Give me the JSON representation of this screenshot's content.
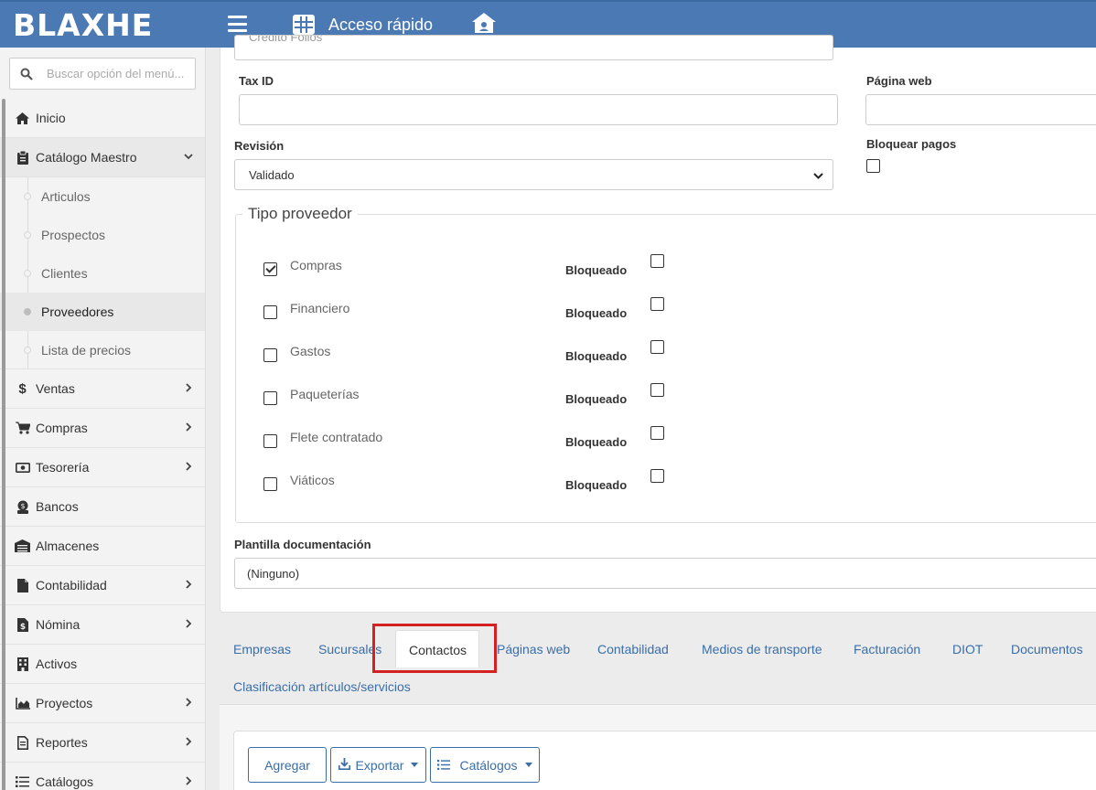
{
  "header": {
    "logo": "BLAXHE",
    "quick_access": "Acceso rápido"
  },
  "sidebar": {
    "search_placeholder": "Buscar opción del menú...",
    "items": [
      {
        "label": "Inicio",
        "icon": "home-icon"
      },
      {
        "label": "Catálogo Maestro",
        "icon": "clipboard-icon",
        "expanded": true,
        "children": [
          "Articulos",
          "Prospectos",
          "Clientes",
          "Proveedores",
          "Lista de precios"
        ],
        "active_child": "Proveedores"
      },
      {
        "label": "Ventas",
        "icon": "dollar-icon"
      },
      {
        "label": "Compras",
        "icon": "cart-icon"
      },
      {
        "label": "Tesorería",
        "icon": "money-icon"
      },
      {
        "label": "Bancos",
        "icon": "bank-icon"
      },
      {
        "label": "Almacenes",
        "icon": "warehouse-icon"
      },
      {
        "label": "Contabilidad",
        "icon": "document-icon"
      },
      {
        "label": "Nómina",
        "icon": "payroll-icon"
      },
      {
        "label": "Activos",
        "icon": "building-icon"
      },
      {
        "label": "Proyectos",
        "icon": "area-chart-icon"
      },
      {
        "label": "Reportes",
        "icon": "report-icon"
      },
      {
        "label": "Catálogos",
        "icon": "list-icon"
      }
    ]
  },
  "form": {
    "top_partial_value": "Crédito Folios",
    "tax_id": {
      "label": "Tax ID",
      "value": ""
    },
    "website": {
      "label": "Página web",
      "value": ""
    },
    "revision": {
      "label": "Revisión",
      "value": "Validado"
    },
    "block_payments": {
      "label": "Bloquear pagos",
      "checked": false
    },
    "supplier_type": {
      "legend": "Tipo proveedor",
      "blocked_label": "Bloqueado",
      "options": [
        {
          "label": "Compras",
          "checked": true,
          "blocked": false
        },
        {
          "label": "Financiero",
          "checked": false,
          "blocked": false
        },
        {
          "label": "Gastos",
          "checked": false,
          "blocked": false
        },
        {
          "label": "Paqueterías",
          "checked": false,
          "blocked": false
        },
        {
          "label": "Flete contratado",
          "checked": false,
          "blocked": false
        },
        {
          "label": "Viáticos",
          "checked": false,
          "blocked": false
        }
      ]
    },
    "doc_template": {
      "label": "Plantilla documentación",
      "value": "(Ninguno)"
    }
  },
  "tabs": {
    "items": [
      "Empresas",
      "Sucursales",
      "Contactos",
      "Páginas web",
      "Contabilidad",
      "Medios de transporte",
      "Facturación",
      "DIOT",
      "Documentos",
      "Clasificación artículos/servicios"
    ],
    "active": "Contactos"
  },
  "toolbar": {
    "add": "Agregar",
    "export": "Exportar",
    "catalogs": "Catálogos"
  },
  "colors": {
    "header_bg": "#4a79b4",
    "link": "#3a6ea8",
    "highlight_border": "#d42121"
  }
}
